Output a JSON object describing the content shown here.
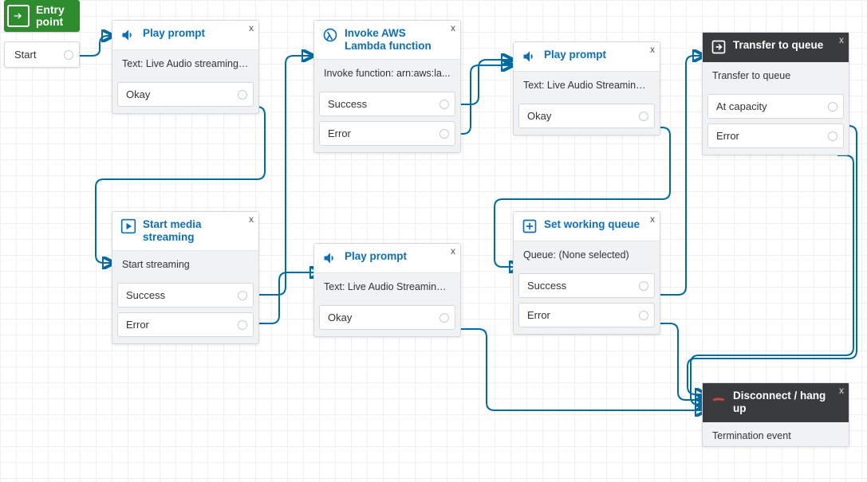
{
  "entry": {
    "label": "Entry\npoint",
    "start": "Start"
  },
  "nodes": {
    "playPrompt1": {
      "title": "Play prompt",
      "body": "Text: Live Audio streaming ...",
      "outlets": [
        "Okay"
      ]
    },
    "startMedia": {
      "title": "Start media streaming",
      "body": "Start streaming",
      "outlets": [
        "Success",
        "Error"
      ]
    },
    "invokeLambda": {
      "title": "Invoke AWS Lambda function",
      "body": "Invoke function: arn:aws:la...",
      "outlets": [
        "Success",
        "Error"
      ]
    },
    "playPrompt2": {
      "title": "Play prompt",
      "body": "Text: Live Audio Streaming ...",
      "outlets": [
        "Okay"
      ]
    },
    "playPrompt3": {
      "title": "Play prompt",
      "body": "Text: Live Audio Streaming ...",
      "outlets": [
        "Okay"
      ]
    },
    "setQueue": {
      "title": "Set working queue",
      "body": "Queue: (None selected)",
      "outlets": [
        "Success",
        "Error"
      ]
    },
    "transfer": {
      "title": "Transfer to queue",
      "body": "Transfer to queue",
      "outlets": [
        "At capacity",
        "Error"
      ]
    },
    "disconnect": {
      "title": "Disconnect / hang up",
      "body": "Termination event"
    }
  },
  "close": "x"
}
